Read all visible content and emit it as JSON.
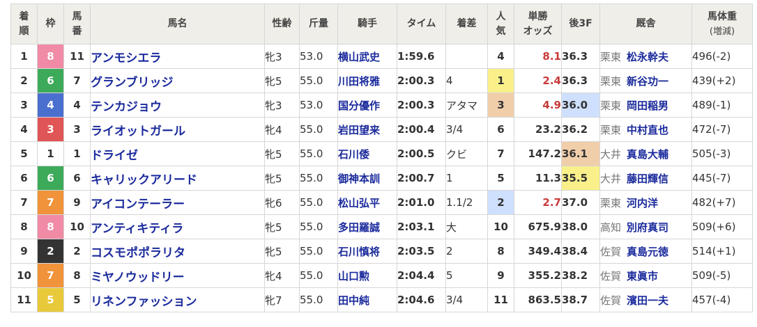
{
  "headers": {
    "rank": [
      "着",
      "順"
    ],
    "gate": "枠",
    "num": [
      "馬",
      "番"
    ],
    "horse": "馬名",
    "sex_age": "性齢",
    "weight": "斤量",
    "jockey": "騎手",
    "time": "タイム",
    "margin": "着差",
    "pop": [
      "人",
      "気"
    ],
    "odds": [
      "単勝",
      "オッズ"
    ],
    "l3f": "後3F",
    "trainer": "厩舎",
    "body_weight": [
      "馬体重",
      "(増減)"
    ]
  },
  "gate_colors": {
    "1": "#ffffff",
    "2": "#333333",
    "3": "#e05555",
    "4": "#4a6fcf",
    "5": "#e8c93a",
    "6": "#3daa5a",
    "7": "#f0933b",
    "8": "#f08aa5"
  },
  "highlight_colors": {
    "first": "#f9f08a",
    "second": "#cfe0ff",
    "third": "#f1ceaa"
  },
  "rows": [
    {
      "rank": "1",
      "gate": "8",
      "num": "11",
      "horse": "アンモシエラ",
      "sex_age": "牝3",
      "weight": "53.0",
      "jockey": "横山武史",
      "time": "1:59.6",
      "margin": "",
      "pop": "4",
      "odds": "8.1",
      "l3f": "36.3",
      "region": "栗東",
      "trainer": "松永幹夫",
      "body_weight": "496(-2)",
      "odds_red": true,
      "pop_hl": "",
      "l3f_hl": ""
    },
    {
      "rank": "2",
      "gate": "6",
      "num": "7",
      "horse": "グランブリッジ",
      "sex_age": "牝5",
      "weight": "55.0",
      "jockey": "川田将雅",
      "time": "2:00.3",
      "margin": "4",
      "pop": "1",
      "odds": "2.4",
      "l3f": "36.3",
      "region": "栗東",
      "trainer": "新谷功一",
      "body_weight": "439(+2)",
      "odds_red": true,
      "pop_hl": "first",
      "l3f_hl": ""
    },
    {
      "rank": "3",
      "gate": "4",
      "num": "4",
      "horse": "テンカジョウ",
      "sex_age": "牝3",
      "weight": "53.0",
      "jockey": "国分優作",
      "time": "2:00.3",
      "margin": "アタマ",
      "pop": "3",
      "odds": "4.9",
      "l3f": "36.0",
      "region": "栗東",
      "trainer": "岡田稲男",
      "body_weight": "489(-1)",
      "odds_red": true,
      "pop_hl": "third",
      "l3f_hl": "second"
    },
    {
      "rank": "4",
      "gate": "3",
      "num": "3",
      "horse": "ライオットガール",
      "sex_age": "牝4",
      "weight": "55.0",
      "jockey": "岩田望来",
      "time": "2:00.4",
      "margin": "3/4",
      "pop": "6",
      "odds": "23.2",
      "l3f": "36.2",
      "region": "栗東",
      "trainer": "中村直也",
      "body_weight": "472(-7)",
      "odds_red": false,
      "pop_hl": "",
      "l3f_hl": ""
    },
    {
      "rank": "5",
      "gate": "1",
      "num": "1",
      "horse": "ドライゼ",
      "sex_age": "牝5",
      "weight": "55.0",
      "jockey": "石川倭",
      "time": "2:00.5",
      "margin": "クビ",
      "pop": "7",
      "odds": "147.2",
      "l3f": "36.1",
      "region": "大井",
      "trainer": "真島大輔",
      "body_weight": "505(-3)",
      "odds_red": false,
      "pop_hl": "",
      "l3f_hl": "third"
    },
    {
      "rank": "6",
      "gate": "6",
      "num": "6",
      "horse": "キャリックアリード",
      "sex_age": "牝5",
      "weight": "55.0",
      "jockey": "御神本訓",
      "time": "2:00.7",
      "margin": "1",
      "pop": "5",
      "odds": "11.3",
      "l3f": "35.5",
      "region": "大井",
      "trainer": "藤田輝信",
      "body_weight": "445(-7)",
      "odds_red": false,
      "pop_hl": "",
      "l3f_hl": "first"
    },
    {
      "rank": "7",
      "gate": "7",
      "num": "9",
      "horse": "アイコンテーラー",
      "sex_age": "牝6",
      "weight": "55.0",
      "jockey": "松山弘平",
      "time": "2:01.0",
      "margin": "1.1/2",
      "pop": "2",
      "odds": "2.7",
      "l3f": "37.0",
      "region": "栗東",
      "trainer": "河内洋",
      "body_weight": "482(+7)",
      "odds_red": true,
      "pop_hl": "second",
      "l3f_hl": ""
    },
    {
      "rank": "8",
      "gate": "8",
      "num": "10",
      "horse": "アンティキティラ",
      "sex_age": "牝5",
      "weight": "55.0",
      "jockey": "多田羅誠",
      "time": "2:03.1",
      "margin": "大",
      "pop": "10",
      "odds": "675.9",
      "l3f": "38.0",
      "region": "高知",
      "trainer": "別府真司",
      "body_weight": "509(+6)",
      "odds_red": false,
      "pop_hl": "",
      "l3f_hl": ""
    },
    {
      "rank": "9",
      "gate": "2",
      "num": "2",
      "horse": "コスモポポラリタ",
      "sex_age": "牝5",
      "weight": "55.0",
      "jockey": "石川慎将",
      "time": "2:03.5",
      "margin": "2",
      "pop": "8",
      "odds": "349.4",
      "l3f": "38.4",
      "region": "佐賀",
      "trainer": "真島元徳",
      "body_weight": "514(+1)",
      "odds_red": false,
      "pop_hl": "",
      "l3f_hl": ""
    },
    {
      "rank": "10",
      "gate": "7",
      "num": "8",
      "horse": "ミヤノウッドリー",
      "sex_age": "牝4",
      "weight": "55.0",
      "jockey": "山口勲",
      "time": "2:04.4",
      "margin": "5",
      "pop": "9",
      "odds": "355.2",
      "l3f": "38.2",
      "region": "佐賀",
      "trainer": "東眞市",
      "body_weight": "509(-5)",
      "odds_red": false,
      "pop_hl": "",
      "l3f_hl": ""
    },
    {
      "rank": "11",
      "gate": "5",
      "num": "5",
      "horse": "リネンファッション",
      "sex_age": "牝7",
      "weight": "55.0",
      "jockey": "田中純",
      "time": "2:04.6",
      "margin": "3/4",
      "pop": "11",
      "odds": "863.5",
      "l3f": "38.7",
      "region": "佐賀",
      "trainer": "濱田一夫",
      "body_weight": "457(-4)",
      "odds_red": false,
      "pop_hl": "",
      "l3f_hl": ""
    }
  ]
}
